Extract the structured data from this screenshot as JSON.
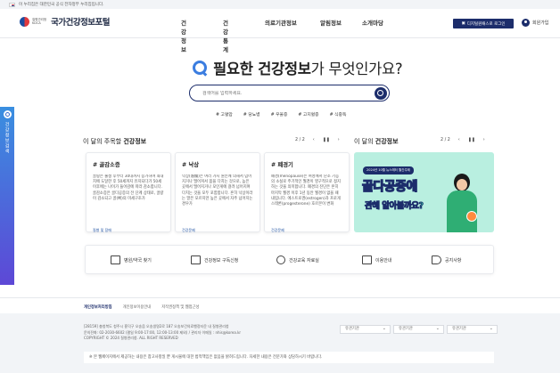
{
  "gov_banner": {
    "text": "이 누리집은 대한민국 공식 전자정부 누리집입니다."
  },
  "header": {
    "logo_sub_1": "질병관리청",
    "logo_sub_2": "KDCA",
    "logo_title": "국가건강정보포털",
    "nav": [
      "건강정보",
      "건강통계",
      "의료기관정보",
      "알림정보",
      "소개마당"
    ],
    "login_label": "디지털원패스로 로그인",
    "signup_label": "회원가입"
  },
  "side_tab": {
    "label": "건강정보검색"
  },
  "hero": {
    "title_bold": "필요한 건강정보",
    "title_rest": "가 무엇인가요?",
    "search_placeholder": "검색어를 입력하세요.",
    "tags": [
      "# 고혈압",
      "# 당뇨병",
      "# 우울증",
      "# 고지혈증",
      "# 식중독"
    ]
  },
  "sections": {
    "featured_prefix": "이 달의 주목할 ",
    "featured_bold": "건강정보",
    "featured_pager": "2 / 2",
    "monthly_prefix": "이 달의 ",
    "monthly_bold": "건강정보",
    "monthly_pager": "2 / 2"
  },
  "cards": [
    {
      "title": "# 골감소증",
      "body": "골량은 출생 후부터 30대까지 증가하며 최대치에 도달한 후 50세까지 유지되다가 50세 이후에는 나이가 들어감에 따라 감소합니다. 골감소증은 골다공증의 전 단계 상태로, 골량이 감소되고 골(뼈)의 미세구조가",
      "category": "질병 및 장애"
    },
    {
      "title": "# 낙상",
      "body": "낙상(落傷)은 여러 가지 원인에 의해서 넘어지거나 떨어져서 몸을 다치는 것으로, 높은 곳에서 떨어지거나 모인게에 걸려 넘어지며 다치는 것을 모두 포함합니다. 흔히 낙상이라는 말은 모르지만 높은 곳에서 자주 넘어지는 경우가",
      "category": "건강문제"
    },
    {
      "title": "# 폐경기",
      "body": "폐경(menopause)은 여성에서 난소 기능의 소실로 주기적인 월경이 영구적으로 정지하는 것을 의미합니다. 폐경의 진단은 흔히 마지막 월경 이후 1년 동안 월경이 없을 때 내립니다. 에스트로겐(estrogen)과 프로게스테론(progesterone) 호르몬이 변화",
      "category": "건강문제"
    }
  ],
  "promo": {
    "top_label": "2024년 10월 뉴스레터 월간주제",
    "main_text": "골다공증에",
    "sub_text": "관해 알아볼까요?"
  },
  "quick_links": [
    "병원/약국 찾기",
    "건강정보 구독신청",
    "건강교육 자료실",
    "이용안내",
    "공지사항"
  ],
  "footer": {
    "links": [
      "개인정보처리방침",
      "개인정보이용안내",
      "저작권정책 및 웹접근성"
    ],
    "address_1": "[28159] 충청북도 청주시 흥덕구 오송읍 오송생명2로 187 오송보건의료행정타운 내 질병관리청",
    "address_2": "문의전화: 02-2030-6602 (평일 9:00-17:00, 12:00-13:00 제외) / 관리자 이메일 : nhis@korea.kr",
    "copyright": "COPYRIGHT © 2024 질병관리청. ALL RIGHT RESERVED",
    "selects": [
      "유관기관",
      "유관기관",
      "유관기관"
    ],
    "notice": "※ 본 웹페이지에서 제공하는 내용은 참고사항일 뿐 게시물에 대한 법적책임은 없음을 밝혀드립니다. 자세한 내용은 전문가와 상담하시기 바랍니다."
  },
  "colors": {
    "primary": "#1c2d6b",
    "accent": "#3b7de0",
    "promo_bg": "#b9efe0",
    "promo_text": "#2fd0a8"
  }
}
